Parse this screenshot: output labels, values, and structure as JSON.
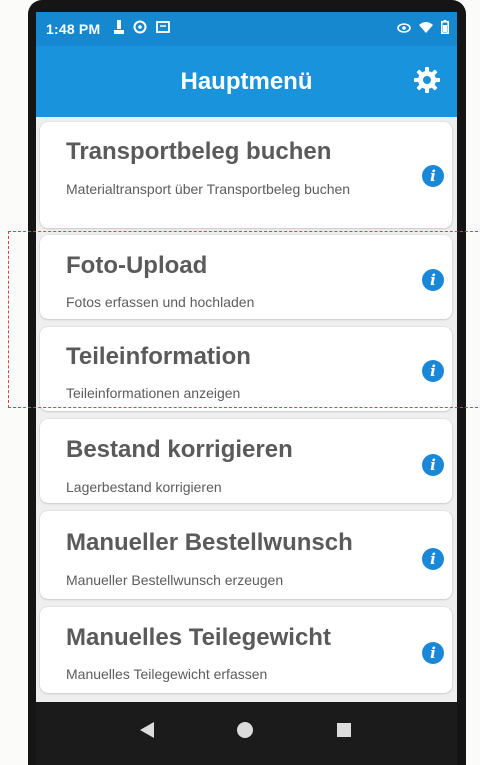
{
  "status_bar": {
    "time": "1:48 PM",
    "left_icons": [
      "notification-icon",
      "sync-icon",
      "message-icon"
    ],
    "right_icons": [
      "eye-icon",
      "wifi-icon",
      "battery-icon"
    ]
  },
  "app_bar": {
    "title": "Hauptmenü",
    "settings_icon": "gear-icon"
  },
  "menu": {
    "items": [
      {
        "title": "Transportbeleg buchen",
        "description": "Materialtransport über Transportbeleg buchen",
        "info_icon": "info-icon",
        "info_glyph": "i"
      },
      {
        "title": "Foto-Upload",
        "description": "Fotos erfassen und hochladen",
        "info_icon": "info-icon",
        "info_glyph": "i"
      },
      {
        "title": "Teileinformation",
        "description": "Teileinformationen anzeigen",
        "info_icon": "info-icon",
        "info_glyph": "i"
      },
      {
        "title": "Bestand korrigieren",
        "description": "Lagerbestand korrigieren",
        "info_icon": "info-icon",
        "info_glyph": "i"
      },
      {
        "title": "Manueller Bestellwunsch",
        "description": "Manueller Bestellwunsch erzeugen",
        "info_icon": "info-icon",
        "info_glyph": "i"
      },
      {
        "title": "Manuelles Teilegewicht",
        "description": "Manuelles Teilegewicht erfassen",
        "info_icon": "info-icon",
        "info_glyph": "i"
      }
    ]
  },
  "nav_bar": {
    "buttons": [
      "back-icon",
      "home-icon",
      "recent-apps-icon"
    ]
  },
  "colors": {
    "status_bar": "#1588d0",
    "app_bar": "#1a93dd",
    "info_button": "#1a88d6",
    "highlight": "#d64545",
    "nav_bar": "#1b1b1b"
  }
}
